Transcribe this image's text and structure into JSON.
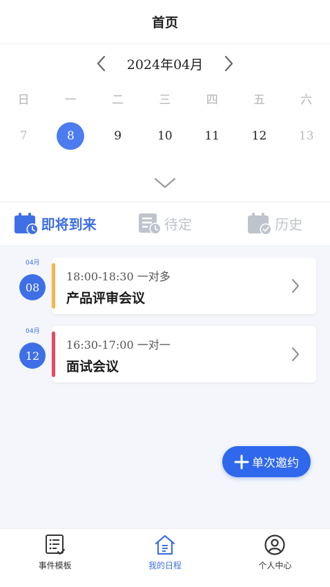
{
  "header": {
    "title": "首页"
  },
  "calendar": {
    "month_label": "2024年04月",
    "weekdays": [
      "日",
      "一",
      "二",
      "三",
      "四",
      "五",
      "六"
    ],
    "days": [
      {
        "num": "7",
        "state": "dim"
      },
      {
        "num": "8",
        "state": "selected"
      },
      {
        "num": "9",
        "state": "normal"
      },
      {
        "num": "10",
        "state": "normal"
      },
      {
        "num": "11",
        "state": "normal"
      },
      {
        "num": "12",
        "state": "normal"
      },
      {
        "num": "13",
        "state": "dim"
      }
    ]
  },
  "tabs": [
    {
      "label": "即将到来",
      "icon": "calendar-clock-icon",
      "active": true
    },
    {
      "label": "待定",
      "icon": "document-clock-icon",
      "active": false
    },
    {
      "label": "历史",
      "icon": "calendar-check-icon",
      "active": false
    }
  ],
  "events": [
    {
      "month": "04月",
      "day": "08",
      "time": "18:00-18:30 一对多",
      "title": "产品评审会议",
      "accent": "#f2b84b"
    },
    {
      "month": "04月",
      "day": "12",
      "time": "16:30-17:00 一对一",
      "title": "面试会议",
      "accent": "#e64a5f"
    }
  ],
  "fab": {
    "label": "单次邀约",
    "icon": "plus-icon"
  },
  "bottom_nav": [
    {
      "label": "事件模板",
      "icon": "template-list-icon",
      "active": false
    },
    {
      "label": "我的日程",
      "icon": "home-schedule-icon",
      "active": true
    },
    {
      "label": "个人中心",
      "icon": "user-icon",
      "active": false
    }
  ],
  "colors": {
    "primary": "#3f6fe6",
    "inactive": "#bfc4cc",
    "background": "#f4f6fb"
  }
}
